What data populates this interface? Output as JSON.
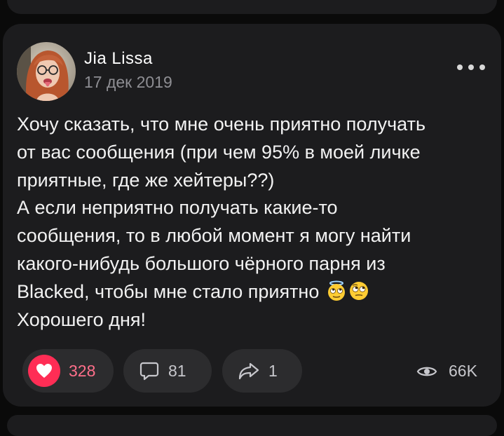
{
  "post": {
    "author": "Jia Lissa",
    "date": "17 дек 2019",
    "avatar_icon": "user-avatar-photo",
    "more_icon": "more-dots-icon",
    "lines": [
      "Хочу сказать, что мне очень приятно получать",
      "от вас сообщения (при чем 95% в моей личке",
      "приятные, где же хейтеры??)",
      "А если неприятно получать какие-то",
      "сообщения, то в любой момент я могу найти",
      "какого-нибудь большого чёрного парня из",
      "Blacked, чтобы мне стало приятно",
      "Хорошего дня!"
    ],
    "emojis": [
      "innocent-rolling-eyes-emoji",
      "rolling-eyes-emoji"
    ]
  },
  "actions": {
    "likes": "328",
    "comments": "81",
    "reposts": "1",
    "views": "66K"
  },
  "colors": {
    "background": "#0a0a0a",
    "card": "#1c1c1e",
    "pill": "#2c2c2e",
    "like_accent": "#ff2d55",
    "text": "#f2f2f2",
    "muted": "#8e8e93"
  }
}
